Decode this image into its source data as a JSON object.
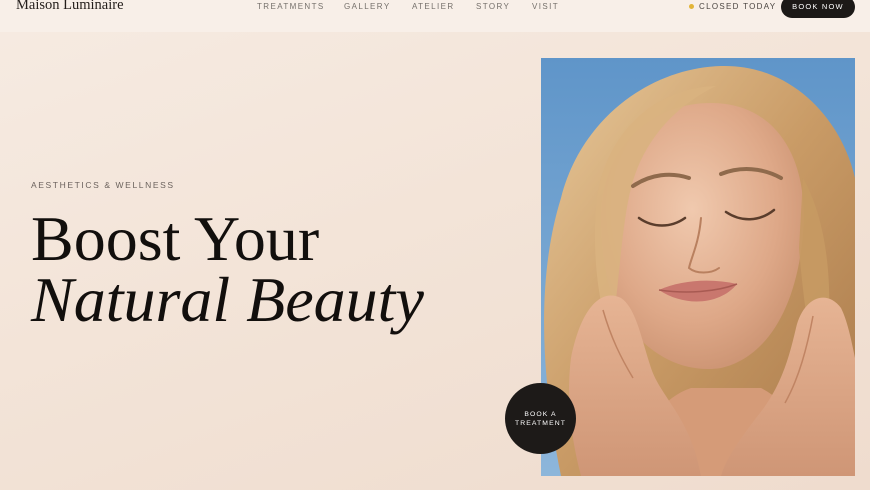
{
  "brand": "Maison Luminaire",
  "nav": {
    "items": [
      {
        "label": "TREATMENTS"
      },
      {
        "label": "GALLERY"
      },
      {
        "label": "ATELIER"
      },
      {
        "label": "STORY"
      },
      {
        "label": "VISIT"
      }
    ]
  },
  "status": {
    "label": "CLOSED TODAY",
    "dot_color": "#e2b437"
  },
  "header": {
    "cta_label": "BOOK NOW"
  },
  "hero": {
    "eyebrow": "AESTHETICS & WELLNESS",
    "headline_line1": "Boost Your",
    "headline_line2": "Natural Beauty"
  },
  "photo": {
    "subject": "Portrait of smiling woman with eyes closed against blue sky"
  },
  "treatment_cta": {
    "line1": "BOOK A",
    "line2": "TREATMENT"
  },
  "colors": {
    "background": "#f3e4d8",
    "button": "#1c1917",
    "sky": "#6ea1cf"
  }
}
